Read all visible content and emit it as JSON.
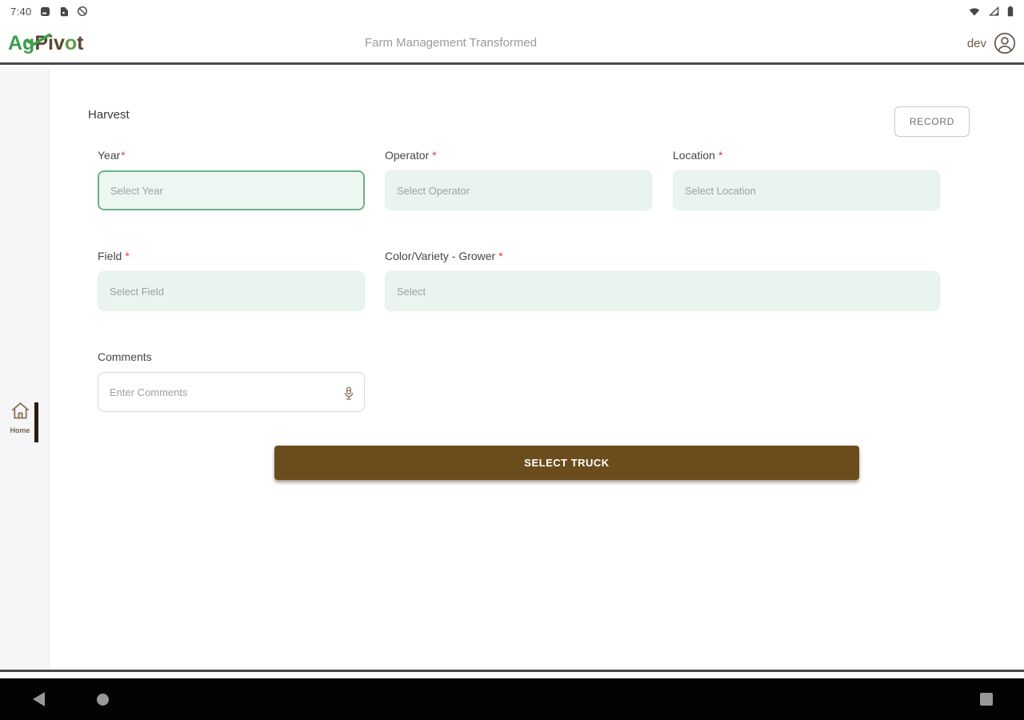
{
  "status_bar": {
    "time": "7:40",
    "left_icons": [
      "screenshot-icon",
      "sim-icon",
      "data-saver-icon"
    ],
    "right_icons": [
      "wifi-icon",
      "signal-icon",
      "battery-icon"
    ]
  },
  "header": {
    "logo_ag": "Ag",
    "logo_piv": "Piv",
    "logo_o": "o",
    "logo_t": "t",
    "tagline": "Farm Management Transformed",
    "user": "dev"
  },
  "sidebar": {
    "home_label": "Home"
  },
  "form": {
    "title": "Harvest",
    "record_button": "RECORD",
    "required_marker": "*",
    "fields": [
      {
        "label": "Year",
        "required": true,
        "placeholder": "Select Year",
        "state": "focused"
      },
      {
        "label": "Operator",
        "required": true,
        "placeholder": "Select Operator"
      },
      {
        "label": "Location",
        "required": true,
        "placeholder": "Select Location"
      },
      {
        "label": "Field",
        "required": true,
        "placeholder": "Select Field"
      },
      {
        "label": "Color/Variety - Grower",
        "required": true,
        "placeholder": "Select"
      },
      {
        "label": "Comments",
        "required": false,
        "placeholder": "Enter Comments",
        "has_mic": true
      }
    ],
    "submit_button": "SELECT TRUCK"
  },
  "nav_bar": {
    "buttons": [
      "back",
      "home",
      "recents"
    ]
  },
  "colors": {
    "brand_green": "#3c9e4e",
    "brand_brown": "#5b4733",
    "button_brown": "#6b4d1d",
    "focus_green": "#6fb08d",
    "mint_bg": "#e9f4ee",
    "required_red": "#e53935"
  }
}
